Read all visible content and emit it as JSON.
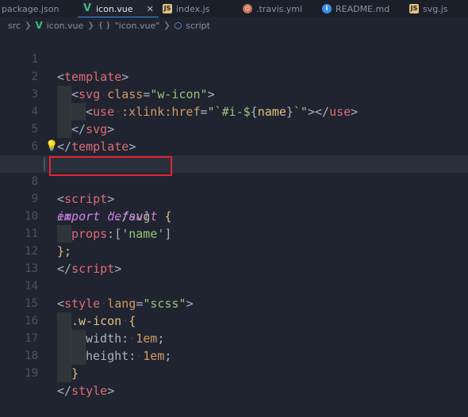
{
  "tabs": [
    {
      "label": "package.json",
      "icon": "package-json-icon"
    },
    {
      "label": "icon.vue",
      "icon": "vue-icon",
      "close": "✕",
      "active": true
    },
    {
      "label": "index.js",
      "icon": "js-icon"
    },
    {
      "label": ".travis.yml",
      "icon": "travis-icon"
    },
    {
      "label": "README.md",
      "icon": "info-icon"
    },
    {
      "label": "svg.js",
      "icon": "js-icon"
    }
  ],
  "breadcrumb": {
    "folder": "src",
    "file": "icon.vue",
    "section": "\"icon.vue\"",
    "symbol": "script",
    "braces": "{ }"
  },
  "editor": {
    "line_numbers": [
      "1",
      "2",
      "3",
      "4",
      "5",
      "6",
      "7",
      "8",
      "9",
      "10",
      "11",
      "12",
      "13",
      "14",
      "15",
      "16",
      "17",
      "18",
      "19"
    ],
    "highlighted_line": "8",
    "code": {
      "l1": {
        "open": "<",
        "name": "template",
        "close": ">"
      },
      "l2": {
        "open": "<",
        "name": "svg",
        "attr": "class",
        "eq": "=",
        "value": "\"w-icon\"",
        "close": ">"
      },
      "l3": {
        "open": "<",
        "name": "use",
        "attr": ":xlink:href",
        "eq": "=",
        "q1": "\"`#i-$",
        "brace_open": "{",
        "var": "name",
        "brace_close": "}",
        "q2": "`\"",
        "close1": ">",
        "closing": "</",
        "closing_name": "use",
        "close2": ">"
      },
      "l4": {
        "open": "</",
        "name": "svg",
        "close": ">"
      },
      "l5": {
        "open": "</",
        "name": "template",
        "close": ">"
      },
      "l7": {
        "open": "<",
        "name": "script",
        "close": ">"
      },
      "l8": {
        "kw": "import",
        "str": "'./svg'"
      },
      "l9": {
        "kw1": "export",
        "kw2": "default",
        "brace": "{"
      },
      "l10": {
        "prop": "props",
        "colon": ":",
        "bracket_open": "[",
        "str": "'name'",
        "bracket_close": "]"
      },
      "l11": {
        "text": "};"
      },
      "l12": {
        "open": "</",
        "name": "script",
        "close": ">"
      },
      "l14": {
        "open": "<",
        "name": "style",
        "attr": "lang",
        "eq": "=",
        "value": "\"scss\"",
        "close": ">"
      },
      "l15": {
        "selector": ".w-icon",
        "brace": "{"
      },
      "l16": {
        "prop": "width",
        "colon": ":",
        "value": "1em",
        "semi": ";"
      },
      "l17": {
        "prop": "height",
        "colon": ":",
        "value": "1em",
        "semi": ";"
      },
      "l18": {
        "brace": "}"
      },
      "l19": {
        "open": "</",
        "name": "style",
        "close": ">"
      }
    }
  },
  "colors": {
    "background": "#1f2430",
    "tag": "#e06c75",
    "attr": "#d19a66",
    "string": "#98c379",
    "keyword": "#c678dd",
    "annotation_box": "#e5232f"
  }
}
